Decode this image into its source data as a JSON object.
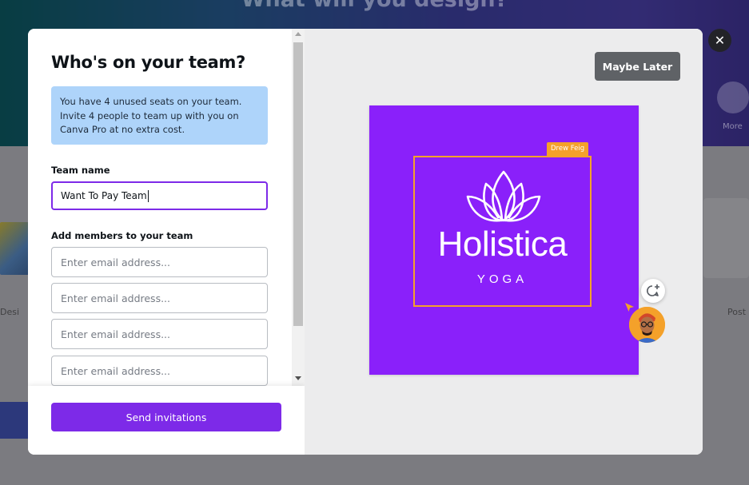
{
  "background": {
    "heading": "What will you design?",
    "left_label": "Desi",
    "right_label": "Post",
    "more_label": "More"
  },
  "modal": {
    "title": "Who's on your team?",
    "info_text": "You have 4 unused seats on your team. Invite 4 people to team up with you on Canva Pro at no extra cost.",
    "team_name_label": "Team name",
    "team_name_value": "Want To Pay Team",
    "members_label": "Add members to your team",
    "email_placeholder": "Enter email address...",
    "email_fields": [
      "",
      "",
      "",
      ""
    ],
    "send_button": "Send invitations",
    "maybe_later": "Maybe Later",
    "close_icon": "close-icon"
  },
  "preview": {
    "collaborator_name": "Drew Feig",
    "brand_name": "Holistica",
    "brand_sub": "YOGA",
    "canvas_color": "#8a20fa",
    "selection_color": "#f4a12a"
  },
  "colors": {
    "accent": "#7d2ae8",
    "info_bg": "#aed4fa",
    "maybe_later_bg": "#5f6266"
  }
}
